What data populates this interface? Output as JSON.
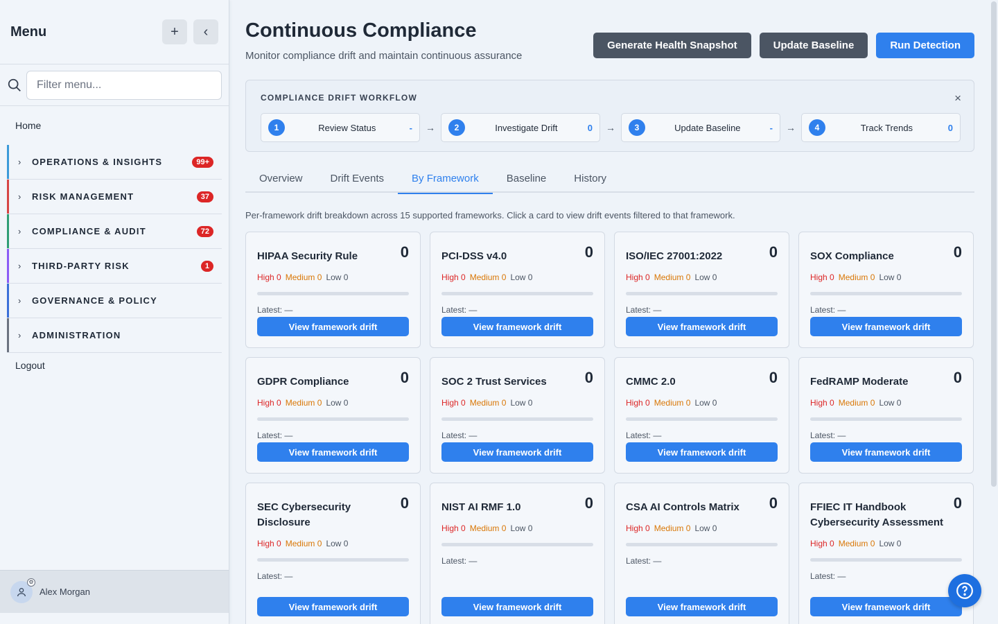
{
  "sidebar": {
    "title": "Menu",
    "add_label": "+",
    "collapse_label": "‹",
    "search_placeholder": "Filter menu...",
    "home": "Home",
    "groups": [
      {
        "label": "OPERATIONS & INSIGHTS",
        "badge": "99+",
        "color": "#3b9ad9"
      },
      {
        "label": "RISK MANAGEMENT",
        "badge": "37",
        "color": "#d64545"
      },
      {
        "label": "COMPLIANCE & AUDIT",
        "badge": "72",
        "color": "#2f9e75"
      },
      {
        "label": "THIRD-PARTY RISK",
        "badge": "1",
        "color": "#8b5cf6"
      },
      {
        "label": "GOVERNANCE & POLICY",
        "badge": "",
        "color": "#3b6fd9"
      },
      {
        "label": "ADMINISTRATION",
        "badge": "",
        "color": "#6b7280"
      }
    ],
    "logout": "Logout",
    "user_name": "Alex Morgan"
  },
  "header": {
    "title": "Continuous Compliance",
    "subtitle": "Monitor compliance drift and maintain continuous assurance",
    "buttons": {
      "snapshot": "Generate Health Snapshot",
      "baseline": "Update Baseline",
      "detect": "Run Detection"
    }
  },
  "workflow": {
    "title": "COMPLIANCE DRIFT WORKFLOW",
    "close": "×",
    "steps": [
      {
        "num": "1",
        "label": "Review Status",
        "count": "-"
      },
      {
        "num": "2",
        "label": "Investigate Drift",
        "count": "0"
      },
      {
        "num": "3",
        "label": "Update Baseline",
        "count": "-"
      },
      {
        "num": "4",
        "label": "Track Trends",
        "count": "0"
      }
    ],
    "arrow": "→"
  },
  "tabs": [
    "Overview",
    "Drift Events",
    "By Framework",
    "Baseline",
    "History"
  ],
  "active_tab": "By Framework",
  "intro": "Per-framework drift breakdown across 15 supported frameworks. Click a card to view drift events filtered to that framework.",
  "severity_labels": {
    "high": "High",
    "medium": "Medium",
    "low": "Low"
  },
  "latest_label": "Latest: —",
  "card_button": "View framework drift",
  "frameworks": [
    {
      "name": "HIPAA Security Rule",
      "total": "0",
      "high": "0",
      "medium": "0",
      "low": "0",
      "progress": 0
    },
    {
      "name": "PCI-DSS v4.0",
      "total": "0",
      "high": "0",
      "medium": "0",
      "low": "0",
      "progress": 0
    },
    {
      "name": "ISO/IEC 27001:2022",
      "total": "0",
      "high": "0",
      "medium": "0",
      "low": "0",
      "progress": 0
    },
    {
      "name": "SOX Compliance",
      "total": "0",
      "high": "0",
      "medium": "0",
      "low": "0",
      "progress": 0
    },
    {
      "name": "GDPR Compliance",
      "total": "0",
      "high": "0",
      "medium": "0",
      "low": "0",
      "progress": 0
    },
    {
      "name": "SOC 2 Trust Services",
      "total": "0",
      "high": "0",
      "medium": "0",
      "low": "0",
      "progress": 0
    },
    {
      "name": "CMMC 2.0",
      "total": "0",
      "high": "0",
      "medium": "0",
      "low": "0",
      "progress": 0
    },
    {
      "name": "FedRAMP Moderate",
      "total": "0",
      "high": "0",
      "medium": "0",
      "low": "0",
      "progress": 0
    },
    {
      "name": "SEC Cybersecurity Disclosure",
      "total": "0",
      "high": "0",
      "medium": "0",
      "low": "0",
      "progress": 0
    },
    {
      "name": "NIST AI RMF 1.0",
      "total": "0",
      "high": "0",
      "medium": "0",
      "low": "0",
      "progress": 0
    },
    {
      "name": "CSA AI Controls Matrix",
      "total": "0",
      "high": "0",
      "medium": "0",
      "low": "0",
      "progress": 0
    },
    {
      "name": "FFIEC IT Handbook Cybersecurity Assessment",
      "total": "0",
      "high": "0",
      "medium": "0",
      "low": "0",
      "progress": 0
    }
  ],
  "colors": {
    "accent": "#2f80ed",
    "high": "#dc2626",
    "medium": "#d97706"
  },
  "icons": {
    "search": "search-icon",
    "help": "help-icon",
    "user": "user-icon"
  }
}
